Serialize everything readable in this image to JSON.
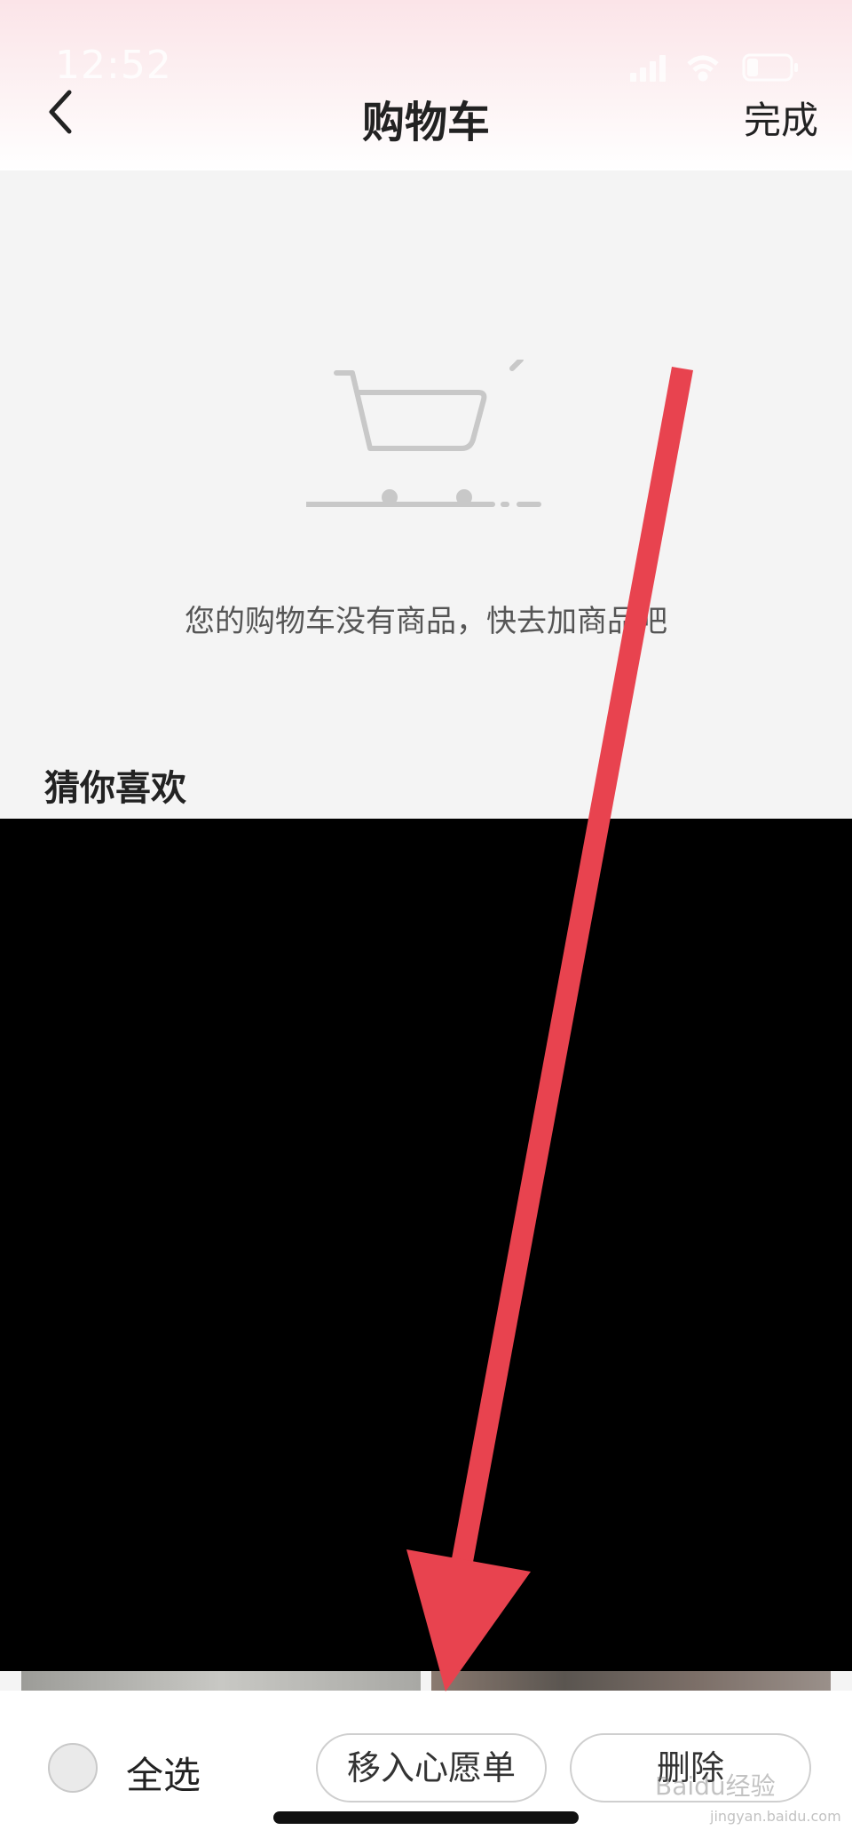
{
  "status_bar": {
    "time": "12:52"
  },
  "header": {
    "title": "购物车",
    "done_label": "完成"
  },
  "empty_cart": {
    "message": "您的购物车没有商品，快去加商品吧"
  },
  "recommend": {
    "title": "猜你喜欢"
  },
  "bottom_bar": {
    "select_all_label": "全选",
    "wishlist_label": "移入心愿单",
    "delete_label": "删除"
  },
  "watermark": {
    "text": "Baidu经验",
    "sub": "jingyan.baidu.com"
  },
  "colors": {
    "arrow": "#e8434f",
    "header_top": "#fbe4e8",
    "background": "#f4f4f4"
  }
}
